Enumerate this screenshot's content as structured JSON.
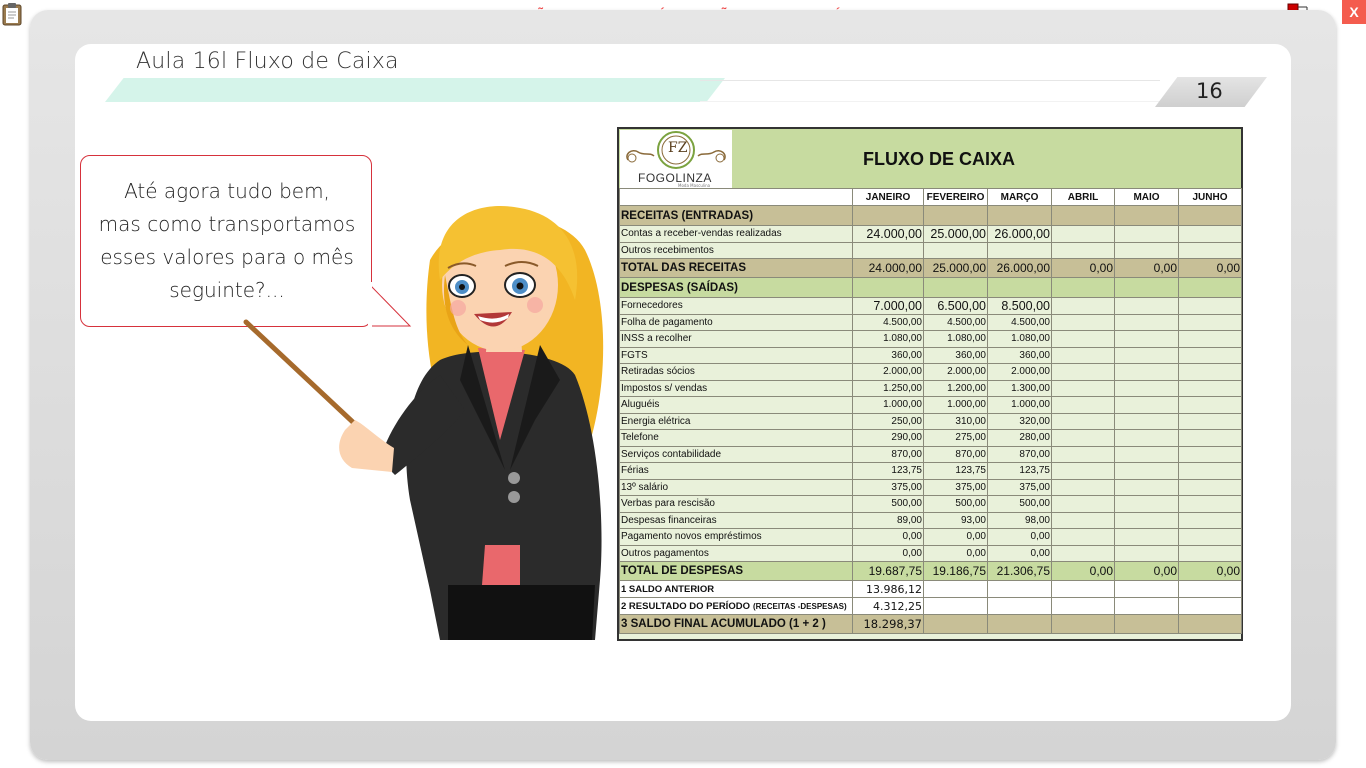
{
  "app": {
    "banner": "VERSÃO PARA FUNCIONÁRIOS - NÃO COMERCIALIZÁVEL",
    "close_label": "X",
    "icons": {
      "clipboard": "clipboard-icon",
      "network": "network-status-icon"
    }
  },
  "slide": {
    "title": "Aula 16l Fluxo de Caixa",
    "page_number": "16",
    "bubble_lines": [
      "Até agora tudo bem,",
      "mas como transportamos",
      "esses valores para o mês",
      "seguinte?..."
    ],
    "accent": "#d5f4ea",
    "bubble_border": "#d6323c"
  },
  "sheet": {
    "title": "FLUXO DE CAIXA",
    "logo_name": "FOGOLINZA",
    "logo_sub": "Moda Masculina",
    "logo_letter": "FZ",
    "months": [
      "JANEIRO",
      "FEVEREIRO",
      "MARÇO",
      "ABRIL",
      "MAIO",
      "JUNHO"
    ],
    "receitas_header": "RECEITAS (ENTRADAS)",
    "receitas": [
      {
        "label": "Contas a receber-vendas realizadas",
        "values": [
          "24.000,00",
          "25.000,00",
          "26.000,00",
          "",
          "",
          ""
        ]
      },
      {
        "label": "Outros recebimentos",
        "values": [
          "",
          "",
          "",
          "",
          "",
          ""
        ]
      }
    ],
    "total_receitas": {
      "label": "TOTAL DAS RECEITAS",
      "values": [
        "24.000,00",
        "25.000,00",
        "26.000,00",
        "0,00",
        "0,00",
        "0,00"
      ]
    },
    "despesas_header": "DESPESAS (SAÍDAS)",
    "despesas": [
      {
        "label": "Fornecedores",
        "values": [
          "7.000,00",
          "6.500,00",
          "8.500,00",
          "",
          "",
          ""
        ]
      },
      {
        "label": "Folha de pagamento",
        "values": [
          "4.500,00",
          "4.500,00",
          "4.500,00",
          "",
          "",
          ""
        ]
      },
      {
        "label": "INSS a recolher",
        "values": [
          "1.080,00",
          "1.080,00",
          "1.080,00",
          "",
          "",
          ""
        ]
      },
      {
        "label": "FGTS",
        "values": [
          "360,00",
          "360,00",
          "360,00",
          "",
          "",
          ""
        ]
      },
      {
        "label": "Retiradas sócios",
        "values": [
          "2.000,00",
          "2.000,00",
          "2.000,00",
          "",
          "",
          ""
        ]
      },
      {
        "label": "Impostos s/ vendas",
        "values": [
          "1.250,00",
          "1.200,00",
          "1.300,00",
          "",
          "",
          ""
        ]
      },
      {
        "label": "Aluguéis",
        "values": [
          "1.000,00",
          "1.000,00",
          "1.000,00",
          "",
          "",
          ""
        ]
      },
      {
        "label": "Energia elétrica",
        "values": [
          "250,00",
          "310,00",
          "320,00",
          "",
          "",
          ""
        ]
      },
      {
        "label": "Telefone",
        "values": [
          "290,00",
          "275,00",
          "280,00",
          "",
          "",
          ""
        ]
      },
      {
        "label": "Serviços contabilidade",
        "values": [
          "870,00",
          "870,00",
          "870,00",
          "",
          "",
          ""
        ]
      },
      {
        "label": "Férias",
        "values": [
          "123,75",
          "123,75",
          "123,75",
          "",
          "",
          ""
        ]
      },
      {
        "label": "13º salário",
        "values": [
          "375,00",
          "375,00",
          "375,00",
          "",
          "",
          ""
        ]
      },
      {
        "label": "Verbas para rescisão",
        "values": [
          "500,00",
          "500,00",
          "500,00",
          "",
          "",
          ""
        ]
      },
      {
        "label": "Despesas financeiras",
        "values": [
          "89,00",
          "93,00",
          "98,00",
          "",
          "",
          ""
        ]
      },
      {
        "label": "Pagamento novos empréstimos",
        "values": [
          "0,00",
          "0,00",
          "0,00",
          "",
          "",
          ""
        ]
      },
      {
        "label": "Outros pagamentos",
        "values": [
          "0,00",
          "0,00",
          "0,00",
          "",
          "",
          ""
        ]
      }
    ],
    "total_despesas": {
      "label": "TOTAL DE DESPESAS",
      "values": [
        "19.687,75",
        "19.186,75",
        "21.306,75",
        "0,00",
        "0,00",
        "0,00"
      ]
    },
    "saldo_anterior": {
      "label": "1 SALDO ANTERIOR",
      "values": [
        "13.986,12",
        "",
        "",
        "",
        "",
        ""
      ]
    },
    "resultado": {
      "label": "2 RESULTADO DO PERÍODO",
      "label_suffix": "(RECEITAS -DESPESAS)",
      "values": [
        "4.312,25",
        "",
        "",
        "",
        "",
        ""
      ]
    },
    "saldo_final": {
      "label": "3 SALDO FINAL ACUMULADO (1 + 2 )",
      "values": [
        "18.298,37",
        "",
        "",
        "",
        "",
        ""
      ]
    },
    "colors": {
      "header_green": "#c7dba0",
      "section_khaki": "#c7bf97",
      "row_light": "#e9f1da"
    }
  }
}
